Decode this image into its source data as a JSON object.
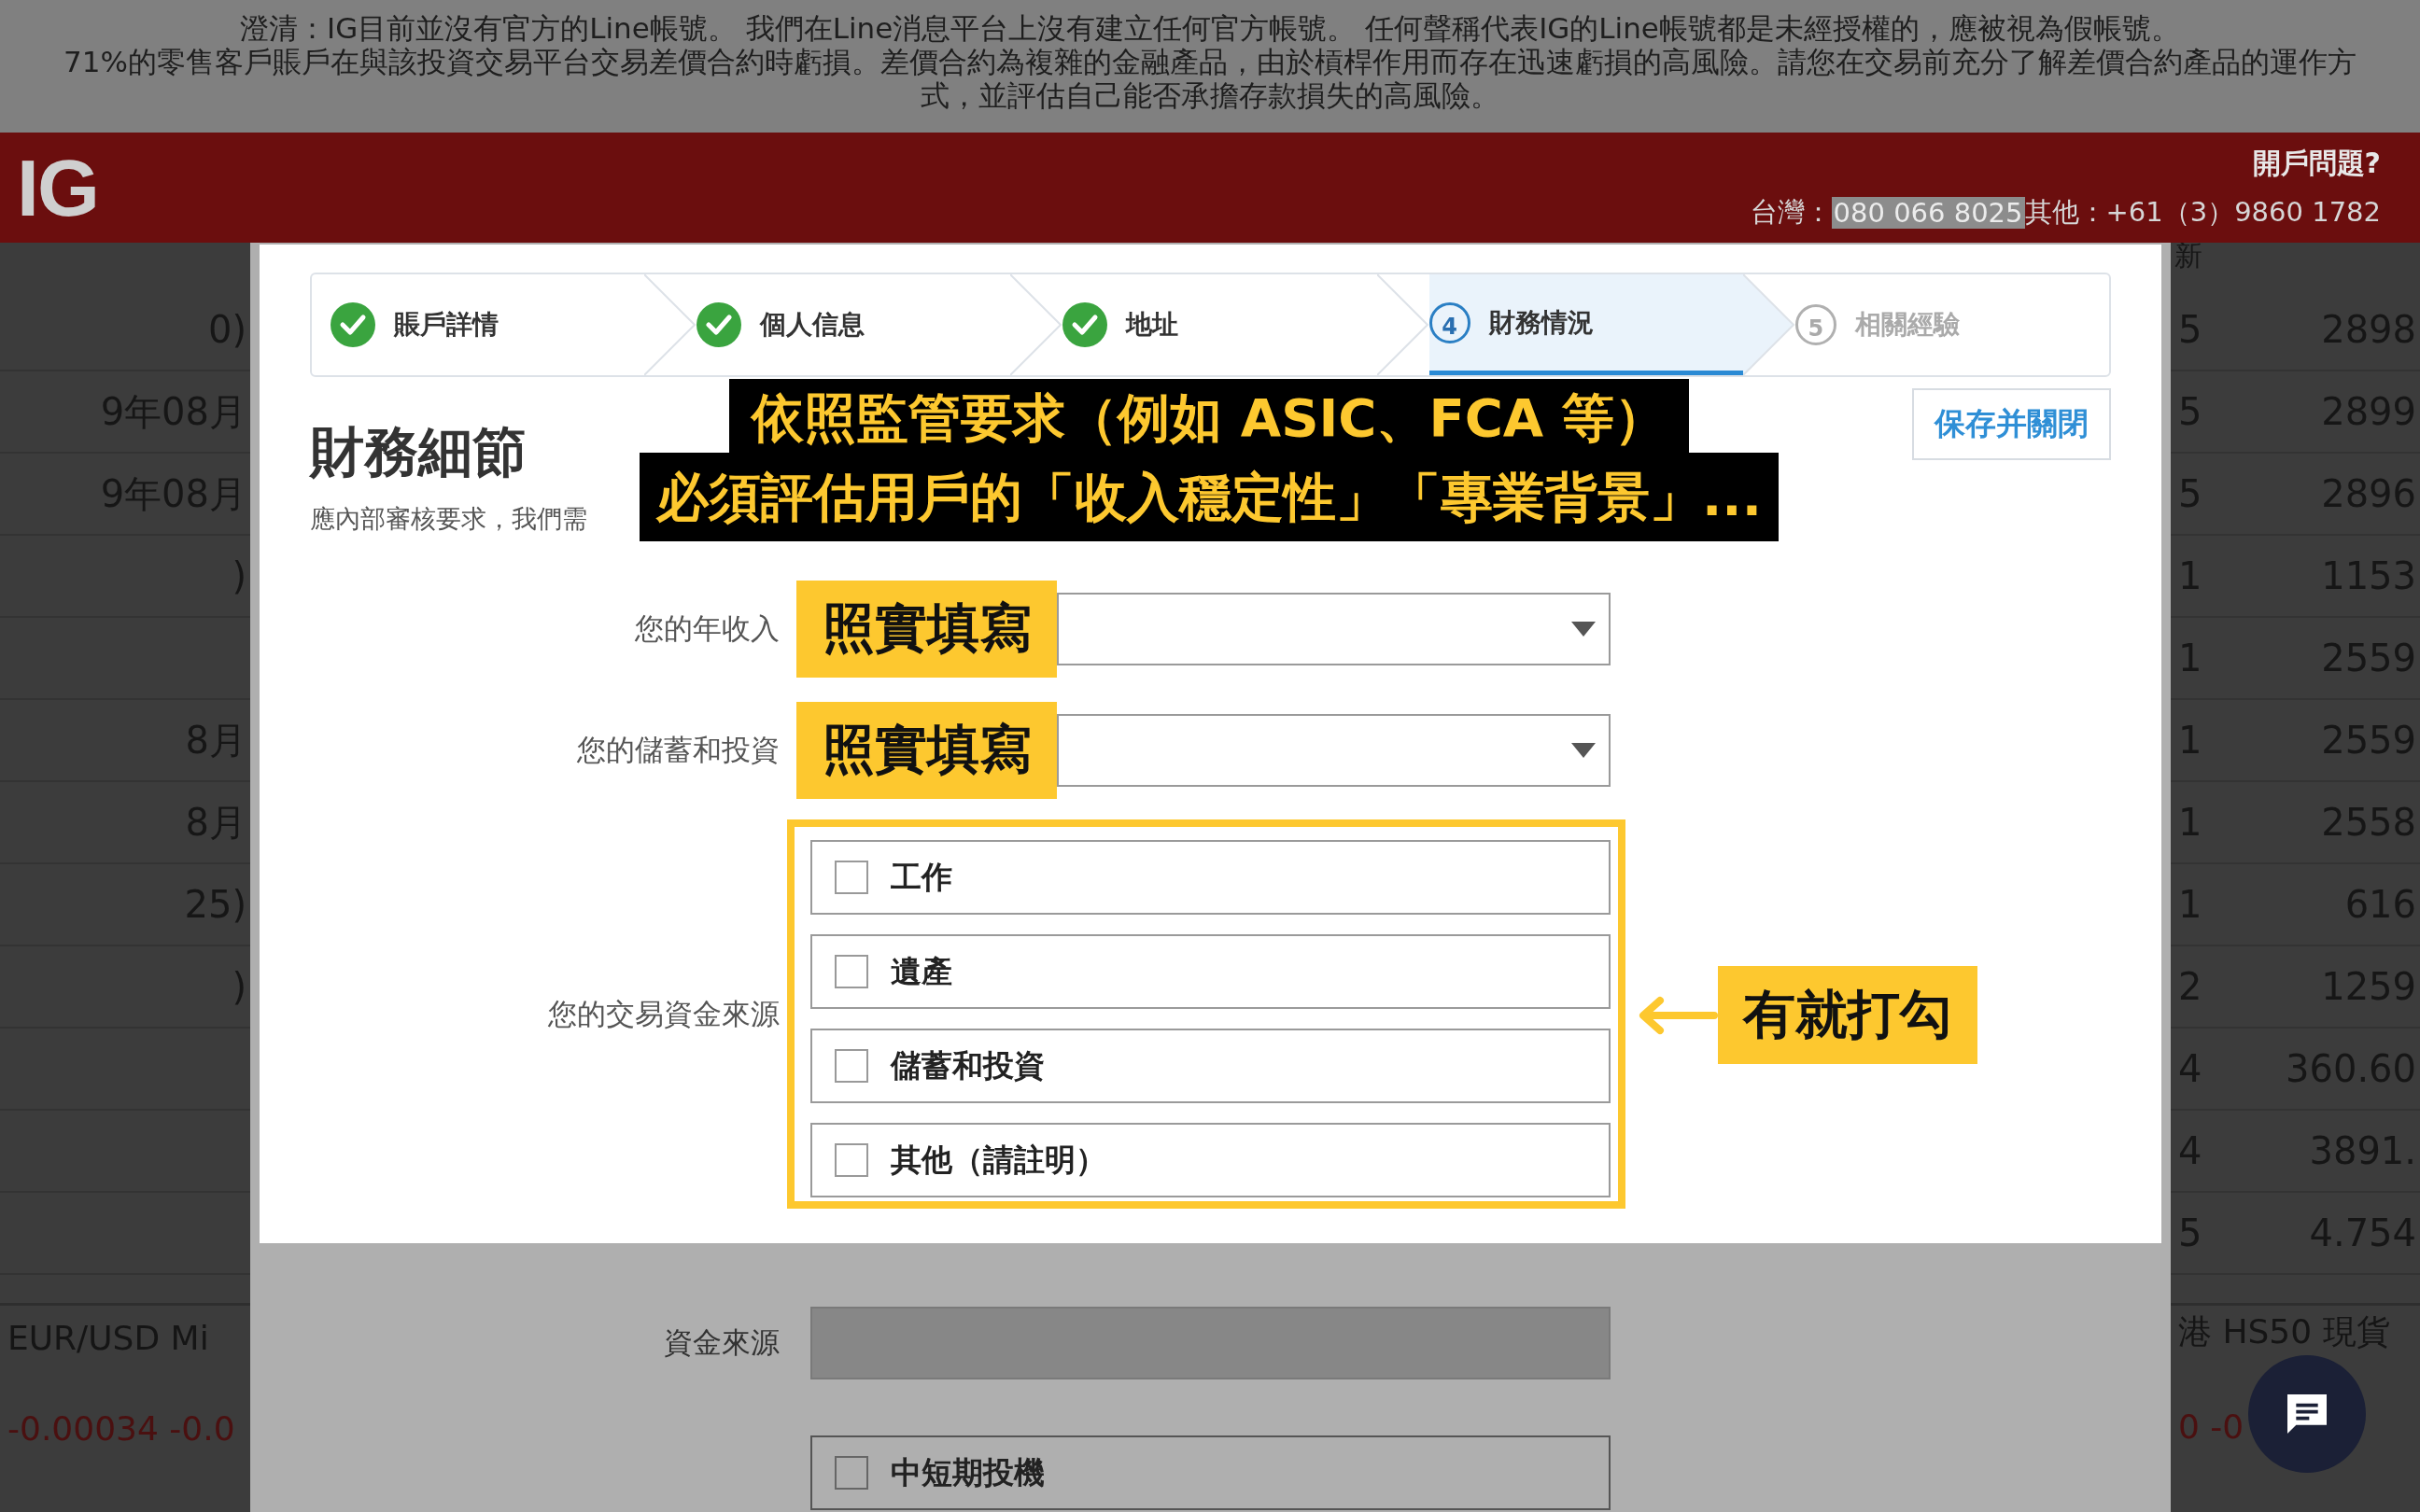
{
  "disclaimer": [
    "澄清：IG目前並沒有官方的Line帳號。 我們在Line消息平台上沒有建立任何官方帳號。 任何聲稱代表IG的Line帳號都是未經授權的，應被視為假帳號。",
    "71%的零售客戶賬戶在與該投資交易平台交易差價合約時虧損。差價合約為複雜的金融產品，由於槓桿作用而存在迅速虧損的高風險。請您在交易前充分了解差價合約產品的運作方式，並評估自己能否承擔存款損失的高風險。"
  ],
  "header": {
    "logo": "IG",
    "help_title": "開戶問題?",
    "tw_label": "台灣：",
    "tw_phone": "080 066 8025",
    "other_phone": "其他：+61（3）9860 1782"
  },
  "background": {
    "left_rows": [
      "0)",
      "9年08月",
      "9年08月",
      ")",
      "",
      "8月",
      "8月",
      "25)",
      ")",
      "",
      "",
      ""
    ],
    "left_footer": {
      "name": "EUR/USD Mi",
      "change": "-0.00034  -0.0"
    },
    "right_header": "新",
    "right_rows": [
      {
        "col_1": "5",
        "col_2": "2898"
      },
      {
        "col_1": "5",
        "col_2": "2899"
      },
      {
        "col_1": "5",
        "col_2": "2896"
      },
      {
        "col_1": "1",
        "col_2": "1153"
      },
      {
        "col_1": "1",
        "col_2": "2559"
      },
      {
        "col_1": "1",
        "col_2": "2559"
      },
      {
        "col_1": "1",
        "col_2": "2558"
      },
      {
        "col_1": "1",
        "col_2": "616"
      },
      {
        "col_1": "2",
        "col_2": "1259"
      },
      {
        "col_1": "4",
        "col_2": "360.60"
      },
      {
        "col_1": "4",
        "col_2": "3891."
      },
      {
        "col_1": "5",
        "col_2": "4.754"
      }
    ],
    "right_footer": {
      "name": "港 HS50 現貨",
      "change": "0  -0"
    }
  },
  "steps": [
    {
      "label": "賬戶詳情",
      "completed": true,
      "selected": false
    },
    {
      "label": "個人信息",
      "completed": true,
      "selected": false
    },
    {
      "label": "地址",
      "completed": true,
      "selected": false
    },
    {
      "label": "財務情況",
      "completed": false,
      "selected": true,
      "number": "4"
    },
    {
      "label": "相關經驗",
      "completed": false,
      "selected": false,
      "number": "5"
    }
  ],
  "title": "財務細節",
  "subtitle": "應內部審核要求，我們需",
  "save_button": "保存并關閉",
  "form": {
    "selects": [
      {
        "label": "您的年收入"
      },
      {
        "label": "您的儲蓄和投資"
      }
    ],
    "sources": {
      "label": "您的交易資金來源",
      "options": [
        {
          "label": "工作",
          "checked": false
        },
        {
          "label": "遺產",
          "checked": false
        },
        {
          "label": "儲蓄和投資",
          "checked": false
        },
        {
          "label": "其他（請註明）",
          "checked": false
        }
      ]
    }
  },
  "below": {
    "fund_source": {
      "label": "資金來源",
      "disabled": true
    },
    "purpose_option": {
      "label": "中短期投機",
      "checked": false
    }
  },
  "annotations": {
    "headline": [
      "依照監管要求（例如 ASIC、FCA 等）",
      "必須評估用戶的「收入穩定性」「專業背景」..."
    ],
    "fill_tags": [
      "照實填寫",
      "照實填寫"
    ],
    "check_hint": "有就打勾"
  }
}
